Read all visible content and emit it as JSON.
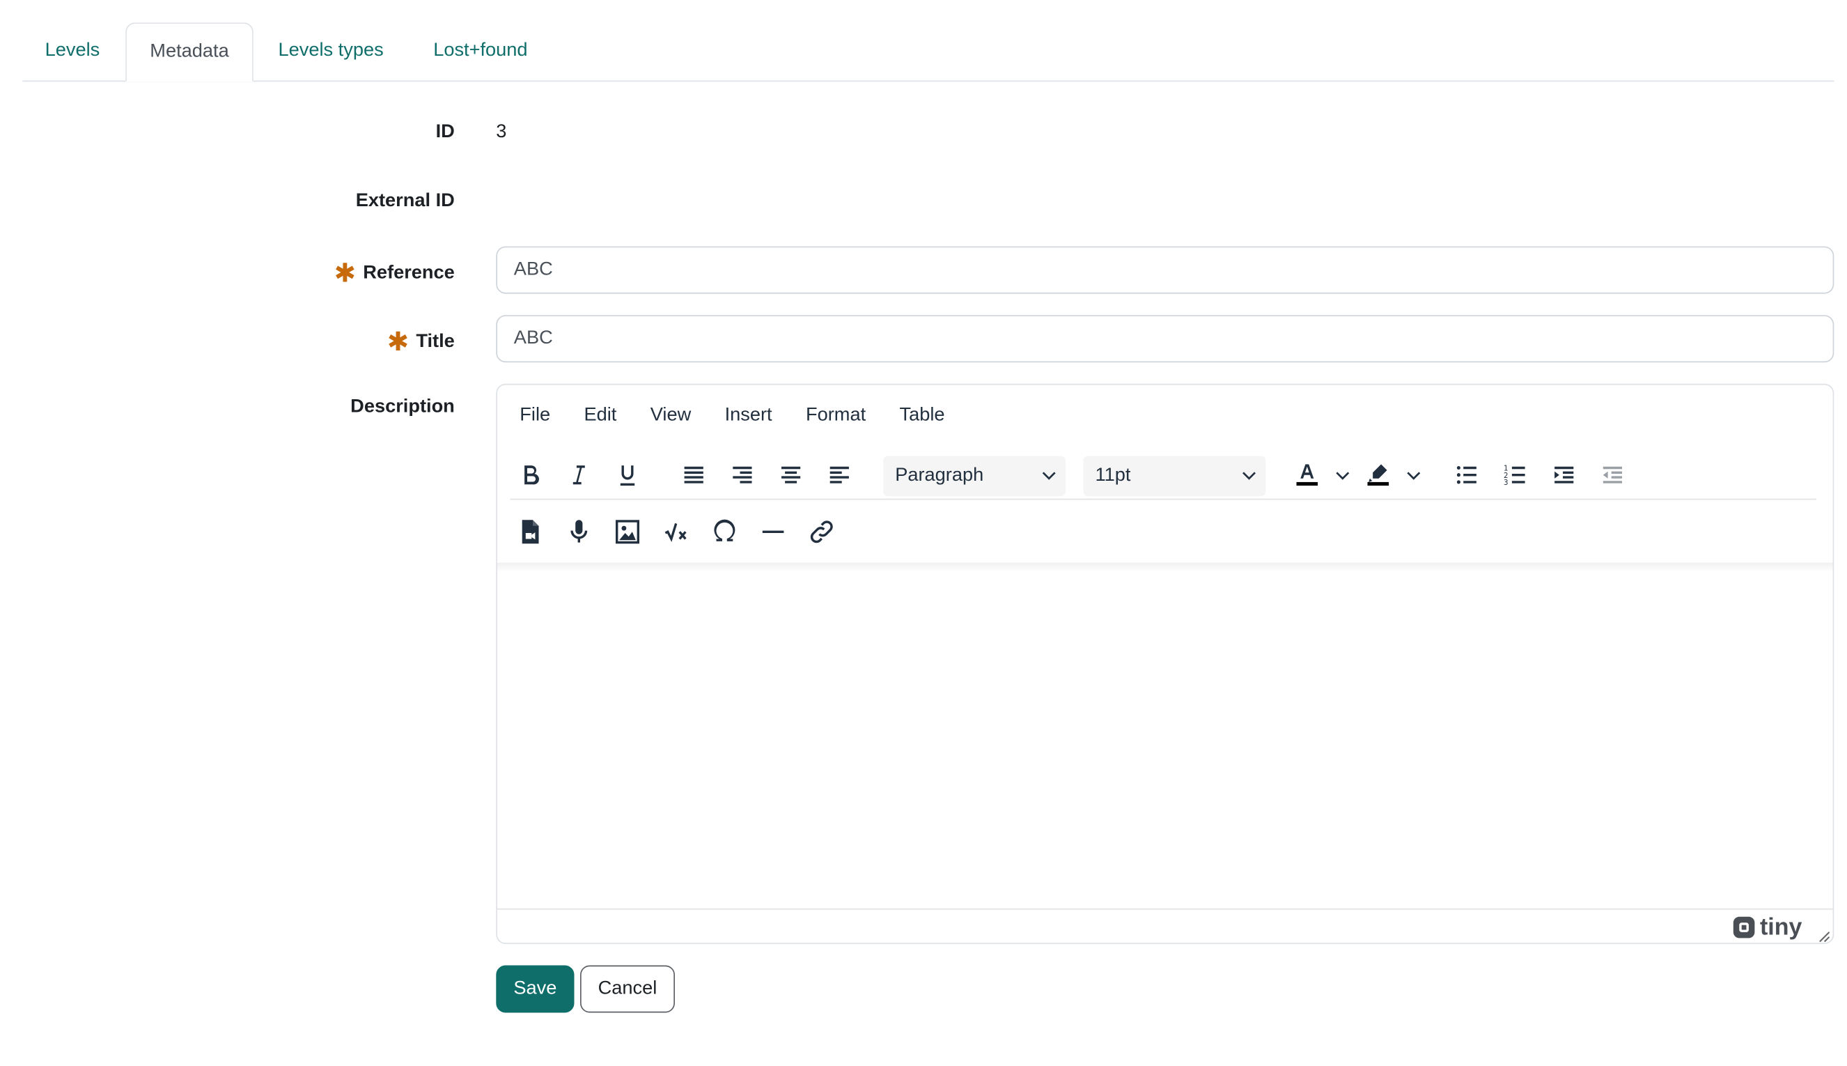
{
  "tabs": [
    {
      "label": "Levels"
    },
    {
      "label": "Metadata"
    },
    {
      "label": "Levels types"
    },
    {
      "label": "Lost+found"
    }
  ],
  "form": {
    "id_label": "ID",
    "id_value": "3",
    "external_id_label": "External ID",
    "external_id_value": "",
    "reference_label": "Reference",
    "reference_value": "ABC",
    "title_label": "Title",
    "title_value": "ABC",
    "description_label": "Description"
  },
  "editor": {
    "menu": [
      "File",
      "Edit",
      "View",
      "Insert",
      "Format",
      "Table"
    ],
    "block_format": "Paragraph",
    "font_size": "11pt",
    "brand": "tiny"
  },
  "buttons": {
    "save": "Save",
    "cancel": "Cancel"
  },
  "colors": {
    "accent": "#0f6e6a",
    "required": "#c66a0c"
  },
  "icons": {
    "row1": [
      "bold-icon",
      "italic-icon",
      "underline-icon",
      "align-justify-icon",
      "align-right-icon",
      "align-center-icon",
      "align-left-icon",
      "text-color-icon",
      "highlight-color-icon",
      "bullet-list-icon",
      "numbered-list-icon",
      "indent-icon",
      "outdent-icon"
    ],
    "row2": [
      "media-file-icon",
      "microphone-icon",
      "image-icon",
      "math-equation-icon",
      "special-character-icon",
      "horizontal-rule-icon",
      "link-icon"
    ]
  }
}
